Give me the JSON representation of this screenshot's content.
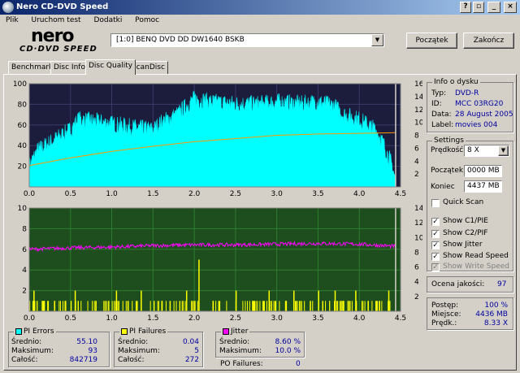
{
  "window": {
    "title": "Nero CD-DVD Speed"
  },
  "menu": [
    "Plik",
    "Uruchom test",
    "Dodatki",
    "Pomoc"
  ],
  "logo": {
    "line1": "nero",
    "line2": "CD·DVD SPEED"
  },
  "drive": {
    "selected": "[1:0]   BENQ DVD DD DW1640 BSKB"
  },
  "buttons": {
    "start": "Początek",
    "stop": "Zakończ"
  },
  "tabs": [
    {
      "label": "Benchmark",
      "active": false
    },
    {
      "label": "Disc Info",
      "active": false
    },
    {
      "label": "Disc Quality",
      "active": true
    },
    {
      "label": "ScanDisc",
      "active": false
    }
  ],
  "disc_info": {
    "title": "Info o dysku",
    "rows": [
      {
        "label": "Typ:",
        "value": "DVD-R"
      },
      {
        "label": "ID:",
        "value": "MCC 03RG20"
      },
      {
        "label": "Data:",
        "value": "28 August 2005"
      },
      {
        "label": "Label:",
        "value": "movies 004"
      }
    ]
  },
  "settings": {
    "title": "Settings",
    "speed_label": "Prędkość",
    "speed_value": "8 X",
    "start_label": "Początek",
    "start_value": "0000 MB",
    "end_label": "Koniec",
    "end_value": "4437 MB",
    "checks": [
      {
        "label": "Quick Scan",
        "checked": false,
        "disabled": false
      },
      {
        "label": "Show C1/PIE",
        "checked": true,
        "disabled": false
      },
      {
        "label": "Show C2/PIF",
        "checked": true,
        "disabled": false
      },
      {
        "label": "Show Jitter",
        "checked": true,
        "disabled": false
      },
      {
        "label": "Show Read Speed",
        "checked": true,
        "disabled": false
      },
      {
        "label": "Show Write Speed",
        "checked": true,
        "disabled": true
      }
    ]
  },
  "quality": {
    "label": "Ocena jakości:",
    "value": "97"
  },
  "progress": {
    "rows": [
      {
        "label": "Postęp:",
        "value": "100 %"
      },
      {
        "label": "Miejsce:",
        "value": "4436 MB"
      },
      {
        "label": "Prędk.:",
        "value": "8.33 X"
      }
    ]
  },
  "pi_errors": {
    "title": "PI Errors",
    "color": "#00ffff",
    "rows": [
      {
        "label": "Średnio:",
        "value": "55.10"
      },
      {
        "label": "Maksimum:",
        "value": "93"
      },
      {
        "label": "Całość:",
        "value": "842719"
      }
    ]
  },
  "pi_failures": {
    "title": "PI Failures",
    "color": "#ffff00",
    "rows": [
      {
        "label": "Średnio:",
        "value": "0.04"
      },
      {
        "label": "Maksimum:",
        "value": "5"
      },
      {
        "label": "Całość:",
        "value": "272"
      }
    ]
  },
  "jitter": {
    "title": "Jitter",
    "color": "#ff00ff",
    "rows": [
      {
        "label": "Średnio:",
        "value": "8.60 %"
      },
      {
        "label": "Maksimum:",
        "value": "10.0 %"
      }
    ]
  },
  "po_failures": {
    "label": "PO Failures:",
    "value": "0"
  },
  "chart_data": [
    {
      "type": "area",
      "series": [
        {
          "name": "PI Errors",
          "color": "#00ffff"
        },
        {
          "name": "Read Speed",
          "color": "#ff9900"
        }
      ],
      "x_ticks": [
        "0.0",
        "0.5",
        "1.0",
        "1.5",
        "2.0",
        "2.5",
        "3.0",
        "3.5",
        "4.0",
        "4.5"
      ],
      "y_ticks_left": [
        "100",
        "80",
        "60",
        "40",
        "20"
      ],
      "y_ticks_right": [
        "16",
        "14",
        "12",
        "10",
        "8",
        "6",
        "4",
        "2"
      ],
      "xlim": [
        0,
        4.5
      ],
      "ylim_left": [
        0,
        100
      ],
      "ylim_right": [
        0,
        16
      ],
      "pi_profile": [
        [
          0.0,
          20
        ],
        [
          0.1,
          35
        ],
        [
          0.3,
          45
        ],
        [
          0.5,
          55
        ],
        [
          0.6,
          65
        ],
        [
          0.9,
          62
        ],
        [
          1.2,
          58
        ],
        [
          1.5,
          55
        ],
        [
          1.6,
          62
        ],
        [
          1.8,
          70
        ],
        [
          1.9,
          78
        ],
        [
          2.0,
          85
        ],
        [
          2.2,
          82
        ],
        [
          2.5,
          80
        ],
        [
          2.8,
          80
        ],
        [
          3.0,
          82
        ],
        [
          3.3,
          80
        ],
        [
          3.5,
          82
        ],
        [
          3.7,
          78
        ],
        [
          3.8,
          70
        ],
        [
          4.0,
          65
        ],
        [
          4.2,
          55
        ],
        [
          4.3,
          40
        ],
        [
          4.4,
          20
        ],
        [
          4.44,
          5
        ]
      ],
      "speed_profile": [
        [
          0.0,
          3.3
        ],
        [
          0.5,
          4.5
        ],
        [
          1.0,
          5.5
        ],
        [
          1.5,
          6.3
        ],
        [
          2.0,
          7.0
        ],
        [
          2.5,
          7.5
        ],
        [
          3.0,
          8.0
        ],
        [
          3.5,
          8.2
        ],
        [
          4.0,
          8.3
        ],
        [
          4.44,
          8.4
        ]
      ]
    },
    {
      "type": "bar",
      "series": [
        {
          "name": "PI Failures",
          "color": "#ffff00"
        },
        {
          "name": "Jitter",
          "color": "#ff00ff"
        }
      ],
      "x_ticks": [
        "0.0",
        "0.5",
        "1.0",
        "1.5",
        "2.0",
        "2.5",
        "3.0",
        "3.5",
        "4.0",
        "4.5"
      ],
      "y_ticks_left": [
        "10",
        "8",
        "6",
        "4",
        "2"
      ],
      "y_ticks_right": [
        "14",
        "12",
        "10",
        "8",
        "6",
        "4",
        "2"
      ],
      "xlim": [
        0,
        4.5
      ],
      "ylim_left": [
        0,
        10
      ],
      "ylim_right": [
        0,
        14
      ],
      "pif_spikes": [
        [
          0.05,
          2
        ],
        [
          0.3,
          1
        ],
        [
          0.55,
          2
        ],
        [
          0.8,
          1
        ],
        [
          1.05,
          2
        ],
        [
          1.3,
          1
        ],
        [
          1.35,
          2
        ],
        [
          1.6,
          1
        ],
        [
          1.7,
          1
        ],
        [
          1.9,
          2
        ],
        [
          2.0,
          1
        ],
        [
          2.05,
          5
        ],
        [
          2.3,
          1
        ],
        [
          2.5,
          2
        ],
        [
          2.7,
          1
        ],
        [
          2.9,
          2
        ],
        [
          3.1,
          1
        ],
        [
          3.2,
          2
        ],
        [
          3.4,
          1
        ],
        [
          3.5,
          2
        ],
        [
          3.55,
          1
        ],
        [
          3.7,
          2
        ],
        [
          3.8,
          1
        ],
        [
          3.95,
          2
        ],
        [
          4.1,
          1
        ],
        [
          4.2,
          1
        ],
        [
          4.35,
          2
        ]
      ],
      "jitter_profile": [
        [
          0.0,
          8.4
        ],
        [
          0.5,
          8.6
        ],
        [
          1.0,
          8.7
        ],
        [
          1.5,
          8.9
        ],
        [
          2.0,
          9.0
        ],
        [
          2.5,
          9.0
        ],
        [
          3.0,
          9.1
        ],
        [
          3.5,
          9.2
        ],
        [
          4.0,
          9.1
        ],
        [
          4.44,
          8.8
        ]
      ]
    }
  ]
}
